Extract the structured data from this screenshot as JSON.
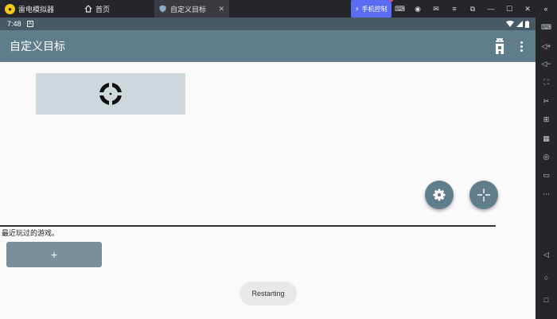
{
  "emulator": {
    "app_name": "雷电模拟器",
    "tabs": [
      {
        "label": "首页",
        "icon": "home-icon"
      },
      {
        "label": "自定义目标",
        "icon": "shield-icon"
      }
    ],
    "phone_control_label": "手机控制",
    "controls": [
      "gamepad-icon",
      "user-icon",
      "mail-icon",
      "menu-icon",
      "restore-icon",
      "minimize-icon",
      "maximize-icon",
      "close-icon",
      "collapse-sidebar-icon"
    ]
  },
  "side_toolbar": [
    "keyboard-icon",
    "volume-up-icon",
    "volume-down-icon",
    "screenshot-icon",
    "cut-icon",
    "add-app-icon",
    "apk-icon",
    "record-icon",
    "folder-icon",
    "more-icon",
    "back-icon",
    "home-circle-icon",
    "recents-icon"
  ],
  "status_bar": {
    "time": "7:48"
  },
  "app_bar": {
    "title": "自定义目标"
  },
  "target_card": {
    "icon": "crosshair-icon"
  },
  "recent_label": "最近玩过的游戏。",
  "add_game_button": "+",
  "toast": "Restarting",
  "colors": {
    "status_bar": "#455a64",
    "app_bar": "#607d8b",
    "fab": "#607d8b",
    "card": "#cfd8dc"
  }
}
